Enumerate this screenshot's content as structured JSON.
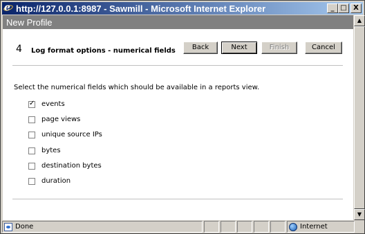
{
  "window": {
    "title": "http://127.0.0.1:8987 - Sawmill - Microsoft Internet Explorer",
    "minimize": "_",
    "maximize": "□",
    "close": "X"
  },
  "header": {
    "title": "New Profile"
  },
  "wizard": {
    "step_number": "4",
    "step_title": "Log format options - numerical fields",
    "buttons": {
      "back": "Back",
      "next": "Next",
      "finish": "Finish",
      "cancel": "Cancel"
    },
    "instruction": "Select the numerical fields which should be available in a reports view.",
    "fields": [
      {
        "label": "events",
        "checked": true
      },
      {
        "label": "page views",
        "checked": false
      },
      {
        "label": "unique source IPs",
        "checked": false
      },
      {
        "label": "bytes",
        "checked": false
      },
      {
        "label": "destination bytes",
        "checked": false
      },
      {
        "label": "duration",
        "checked": false
      }
    ]
  },
  "statusbar": {
    "status": "Done",
    "zone": "Internet"
  }
}
